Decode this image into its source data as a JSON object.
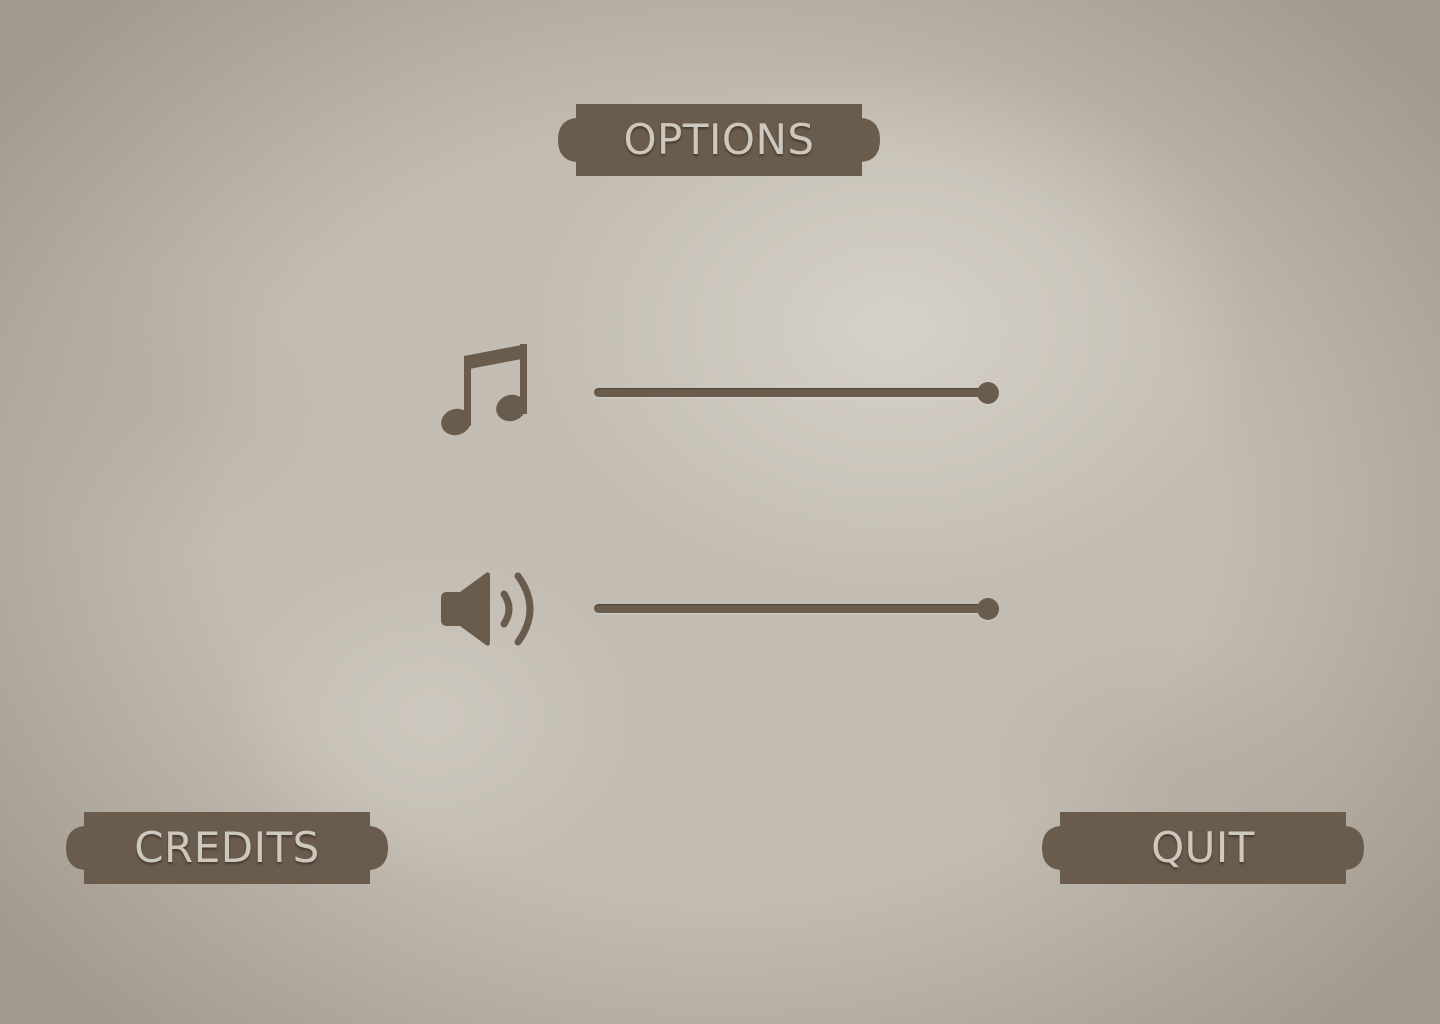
{
  "menu": {
    "title": "OPTIONS",
    "credits_label": "CREDITS",
    "quit_label": "QUIT"
  },
  "settings": {
    "music": {
      "icon": "music-note-icon",
      "level": 1.0
    },
    "sound": {
      "icon": "speaker-volume-icon",
      "level": 1.0
    }
  },
  "theme": {
    "plate_color": "#6a5c4d",
    "label_color": "#cdc8bd",
    "background_color": "#c2bcb2"
  }
}
